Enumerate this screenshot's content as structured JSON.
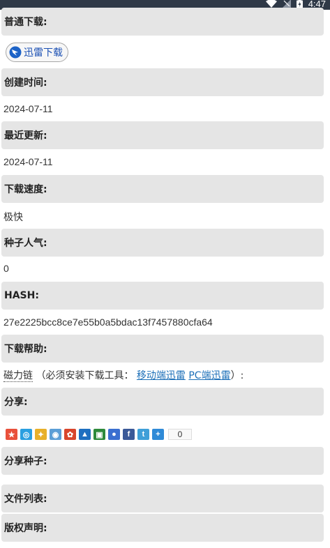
{
  "status_bar": {
    "time": "4:47"
  },
  "sections": {
    "normal_download": {
      "label": "普通下载:"
    },
    "thunder_button": {
      "label": "迅雷下载"
    },
    "created": {
      "label": "创建时间:",
      "value": "2024-07-11"
    },
    "updated": {
      "label": "最近更新:",
      "value": "2024-07-11"
    },
    "speed": {
      "label": "下载速度:",
      "value": "极快"
    },
    "popularity": {
      "label": "种子人气:",
      "value": "0"
    },
    "hash": {
      "label": "HASH:",
      "value": "27e2225bcc8ce7e55b0a5bdac13f7457880cfa64"
    },
    "help": {
      "label": "下载帮助:",
      "magnet": "磁力链",
      "note": "（必须安装下载工具：",
      "mobile_link": "移动端迅雷",
      "pc_link": "PC端迅雷",
      "close": "）:"
    },
    "share": {
      "label": "分享:",
      "count": "0"
    },
    "share_torrent": {
      "label": "分享种子:"
    },
    "file_list": {
      "label": "文件列表:"
    },
    "copyright": {
      "label": "版权声明:"
    }
  },
  "colors": {
    "header_bg": "#e5e5e5",
    "link": "#1c6fb8",
    "thunder_text": "#1a4fb3",
    "status_bar": "#2f3947"
  },
  "share_icons": [
    "qzone-icon",
    "qq-icon",
    "weibo-icon",
    "tencent-weibo-icon",
    "renren-icon",
    "kaixin-icon",
    "douban-icon",
    "baidu-icon",
    "facebook-icon",
    "twitter-icon",
    "more-share-icon"
  ]
}
